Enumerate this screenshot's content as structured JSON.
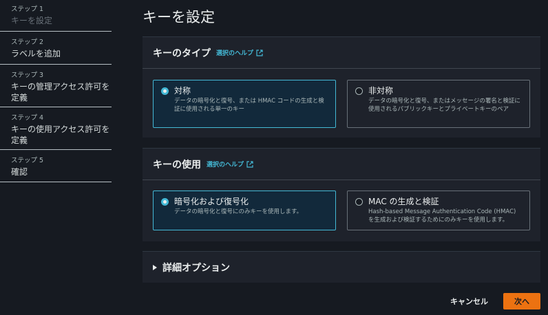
{
  "steps": [
    {
      "num": "ステップ 1",
      "label": "キーを設定"
    },
    {
      "num": "ステップ 2",
      "label": "ラベルを追加"
    },
    {
      "num": "ステップ 3",
      "label": "キーの管理アクセス許可を定義"
    },
    {
      "num": "ステップ 4",
      "label": "キーの使用アクセス許可を定義"
    },
    {
      "num": "ステップ 5",
      "label": "確認"
    }
  ],
  "page_title": "キーを設定",
  "key_type": {
    "title": "キーのタイプ",
    "help": "選択のヘルプ",
    "options": [
      {
        "title": "対称",
        "desc": "データの暗号化と復号、または HMAC コードの生成と検証に使用される単一のキー",
        "selected": true
      },
      {
        "title": "非対称",
        "desc": "データの暗号化と復号、またはメッセージの署名と検証に使用されるパブリックキーとプライベートキーのペア",
        "selected": false
      }
    ]
  },
  "key_usage": {
    "title": "キーの使用",
    "help": "選択のヘルプ",
    "options": [
      {
        "title": "暗号化および復号化",
        "desc": "データの暗号化と復号にのみキーを使用します。",
        "selected": true
      },
      {
        "title": "MAC の生成と検証",
        "desc": "Hash-based Message Authentication Code (HMAC) を生成および検証するためにのみキーを使用します。",
        "selected": false
      }
    ]
  },
  "advanced": {
    "title": "詳細オプション"
  },
  "footer": {
    "cancel": "キャンセル",
    "next": "次へ"
  },
  "colors": {
    "accent": "#44b9d6",
    "primary_button": "#ec7211",
    "background": "#161a21",
    "panel": "#1e222b"
  }
}
